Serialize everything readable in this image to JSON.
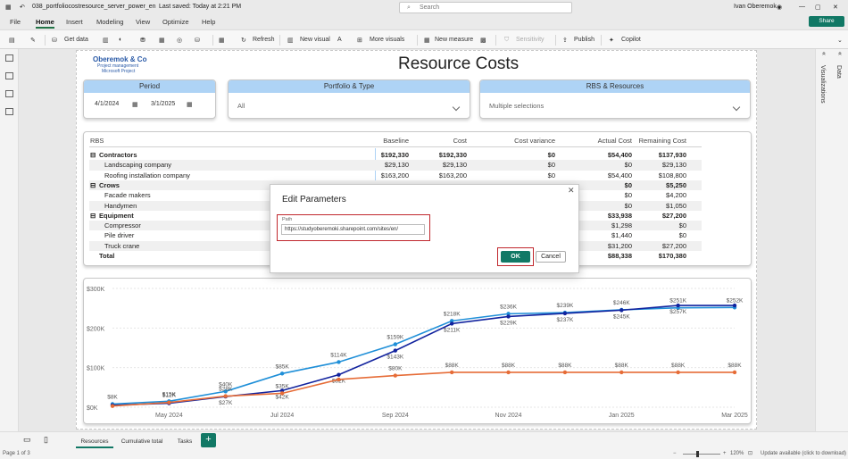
{
  "titlebar": {
    "filename": "038_portfoliocostresource_server_power_en",
    "saved": "Last saved: Today at 2:21 PM",
    "search_placeholder": "Search",
    "user": "Ivan Oberemok"
  },
  "menu": {
    "file": "File",
    "home": "Home",
    "insert": "Insert",
    "modeling": "Modeling",
    "view": "View",
    "optimize": "Optimize",
    "help": "Help",
    "share": "Share"
  },
  "ribbon": {
    "get_data": "Get data",
    "refresh": "Refresh",
    "new_visual": "New visual",
    "more_visuals": "More visuals",
    "new_measure": "New measure",
    "sensitivity": "Sensitivity",
    "publish": "Publish",
    "copilot": "Copilot"
  },
  "panes": {
    "visualizations": "Visualizations",
    "data": "Data"
  },
  "logo": {
    "name": "Oberemok & Co",
    "line1": "Project management",
    "line2": "Microsoft Project"
  },
  "page_title": "Resource Costs",
  "period": {
    "title": "Period",
    "start": "4/1/2024",
    "end": "3/1/2025"
  },
  "portfolio": {
    "title": "Portfolio & Type",
    "value": "All"
  },
  "rbs": {
    "title": "RBS & Resources",
    "value": "Multiple selections"
  },
  "matrix": {
    "headers": [
      "RBS",
      "Baseline",
      "Cost",
      "Cost variance",
      "Actual Cost",
      "Remaining Cost"
    ],
    "rows": [
      {
        "label": "Contractors",
        "level": 0,
        "expand": "⊟",
        "vals": [
          "$192,330",
          "$192,330",
          "$0",
          "$54,400",
          "$137,930"
        ]
      },
      {
        "label": "Landscaping company",
        "level": 1,
        "vals": [
          "$29,130",
          "$29,130",
          "$0",
          "$0",
          "$29,130"
        ]
      },
      {
        "label": "Roofing installation company",
        "level": 1,
        "vals": [
          "$163,200",
          "$163,200",
          "$0",
          "$54,400",
          "$108,800"
        ]
      },
      {
        "label": "Crows",
        "level": 0,
        "expand": "⊟",
        "vals": [
          "",
          "",
          "",
          "$0",
          "$5,250"
        ]
      },
      {
        "label": "Facade makers",
        "level": 1,
        "vals": [
          "",
          "",
          "",
          "$0",
          "$4,200"
        ]
      },
      {
        "label": "Handymen",
        "level": 1,
        "vals": [
          "",
          "",
          "",
          "$0",
          "$1,050"
        ]
      },
      {
        "label": "Equipment",
        "level": 0,
        "expand": "⊟",
        "vals": [
          "",
          "",
          "",
          "$33,938",
          "$27,200"
        ]
      },
      {
        "label": "Compressor",
        "level": 1,
        "vals": [
          "",
          "",
          "",
          "$1,298",
          "$0"
        ]
      },
      {
        "label": "Pile driver",
        "level": 1,
        "vals": [
          "",
          "",
          "",
          "$1,440",
          "$0"
        ]
      },
      {
        "label": "Truck crane",
        "level": 1,
        "vals": [
          "",
          "",
          "",
          "$31,200",
          "$27,200"
        ]
      },
      {
        "label": "Total",
        "level": 0,
        "vals": [
          "",
          "",
          "",
          "$88,338",
          "$170,380"
        ]
      }
    ]
  },
  "dialog": {
    "title": "Edit Parameters",
    "close": "✕",
    "path_label": "Path",
    "path_value": "https://studyoberemoki.sharepoint.com/sites/en/",
    "ok": "OK",
    "cancel": "Cancel"
  },
  "chart_data": {
    "type": "line",
    "x": [
      "Apr 2024",
      "May 2024",
      "Jun 2024",
      "Jul 2024",
      "Aug 2024",
      "Sep 2024",
      "Oct 2024",
      "Nov 2024",
      "Dec 2024",
      "Jan 2025",
      "Feb 2025",
      "Mar 2025"
    ],
    "xticks": [
      "May 2024",
      "Jul 2024",
      "Sep 2024",
      "Nov 2024",
      "Jan 2025",
      "Mar 2025"
    ],
    "yticks": [
      "$0K",
      "$100K",
      "$200K",
      "$300K"
    ],
    "ylim": [
      0,
      300
    ],
    "series": [
      {
        "color": "#1f8fd8",
        "values": [
          8,
          15,
          40,
          85,
          114,
          159,
          218,
          236,
          239,
          246,
          251,
          252
        ],
        "labels": [
          "$8K",
          "$15K",
          "$40K",
          "$85K",
          "$114K",
          "$159K",
          "$218K",
          "$236K",
          "$239K",
          "$246K",
          "$251K",
          "$252K"
        ]
      },
      {
        "color": "#12239e",
        "values": [
          5,
          10,
          27,
          42,
          82,
          143,
          211,
          229,
          237,
          245,
          257,
          257
        ],
        "labels": [
          "",
          "",
          "$27K",
          "$42K",
          "$82K",
          "$143K",
          "$211K",
          "$229K",
          "$237K",
          "$245K",
          "$257K",
          ""
        ]
      },
      {
        "color": "#e66c37",
        "values": [
          3,
          12,
          28,
          35,
          70,
          80,
          88,
          88,
          88,
          88,
          88,
          88
        ],
        "labels": [
          "",
          "$12K",
          "$28K",
          "$35K",
          "",
          "$80K",
          "$88K",
          "$88K",
          "$88K",
          "$88K",
          "$88K",
          "$88K"
        ]
      }
    ]
  },
  "tabs": [
    "Resources",
    "Cumulative total",
    "Tasks"
  ],
  "add_tab": "+",
  "status": {
    "page": "Page 1 of 3",
    "zoom": "120%",
    "update": "Update available (click to download)"
  }
}
